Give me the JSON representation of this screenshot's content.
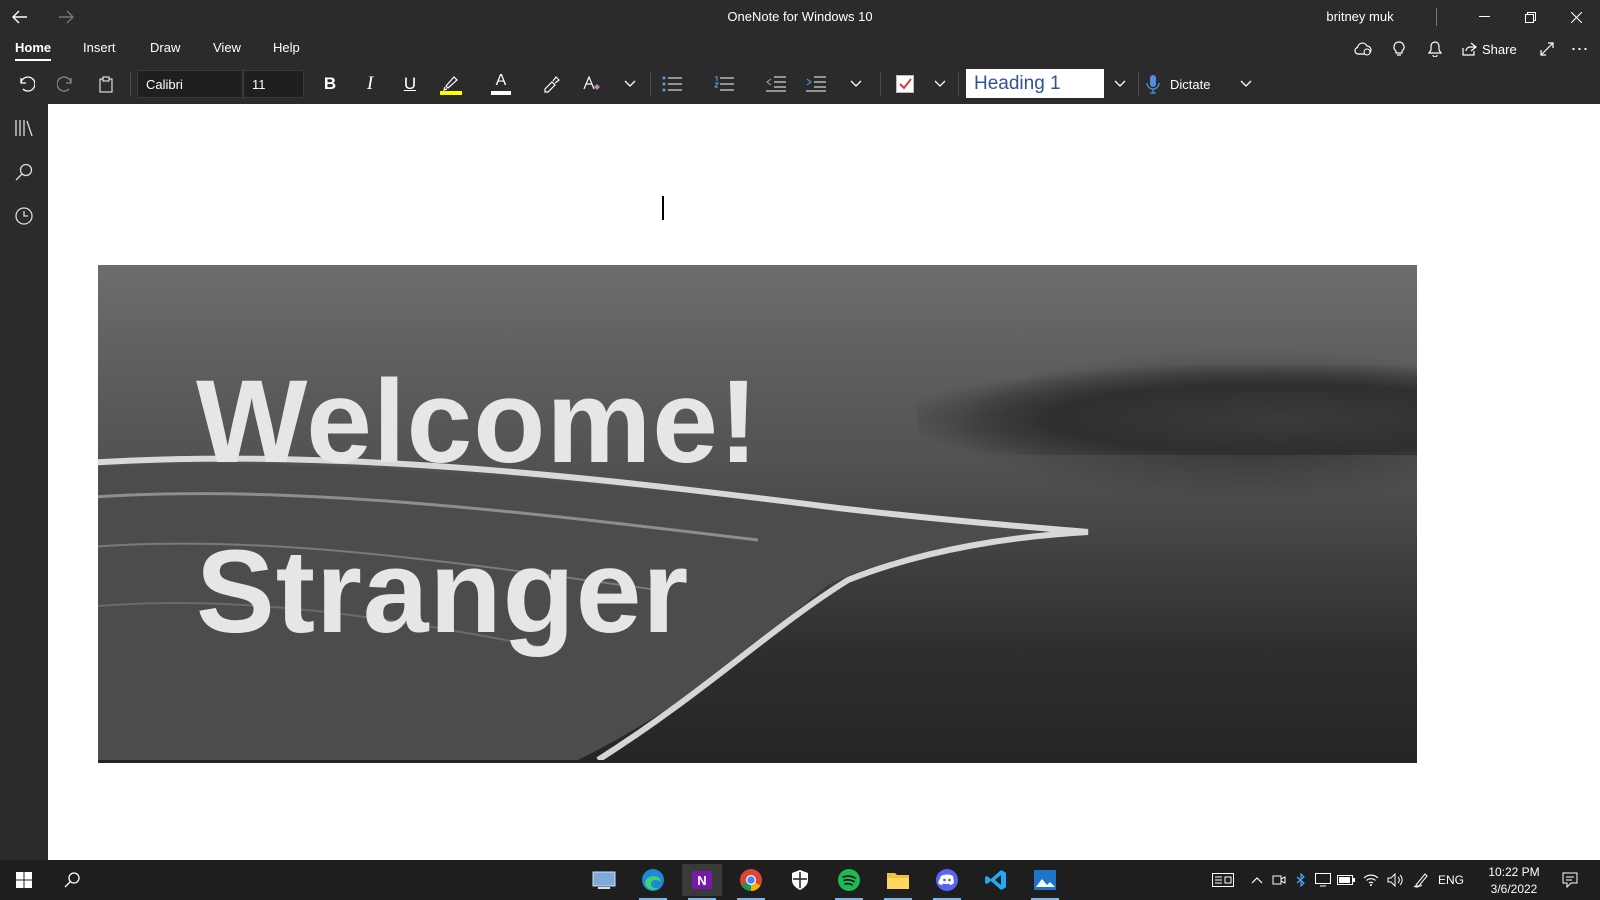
{
  "window": {
    "title": "OneNote for Windows 10",
    "user": "britney muk"
  },
  "menu": {
    "tabs": [
      "Home",
      "Insert",
      "Draw",
      "View",
      "Help"
    ],
    "active_tab": "Home",
    "share_label": "Share"
  },
  "toolbar": {
    "font_name": "Calibri",
    "font_size": "11",
    "bold_label": "B",
    "italic_label": "I",
    "underline_label": "U",
    "font_color_label": "A",
    "style_value": "Heading 1",
    "dictate_label": "Dictate",
    "highlight_color": "#ffff00"
  },
  "page": {
    "image_line1": "Welcome!",
    "image_line2": "Stranger"
  },
  "taskbar": {
    "language": "ENG",
    "time": "10:22 PM",
    "date": "3/6/2022"
  },
  "colors": {
    "chrome": "#2b2b2b",
    "taskbar": "#1e1e1e",
    "heading_style_text": "#2f5496",
    "onenote_purple": "#7719aa"
  }
}
